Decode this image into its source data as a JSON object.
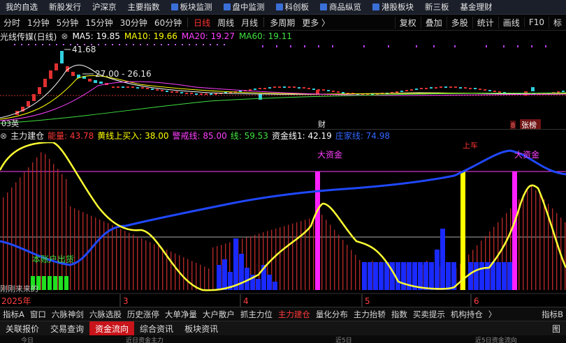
{
  "nav": {
    "items": [
      {
        "label": "我的自选",
        "icon": ""
      },
      {
        "label": "新股发行",
        "icon": ""
      },
      {
        "label": "沪深京",
        "icon": ""
      },
      {
        "label": "主要指数",
        "icon": ""
      },
      {
        "label": "板块监测",
        "icon": "board-icon"
      },
      {
        "label": "盘中监测",
        "icon": "monitor-icon"
      },
      {
        "label": "科创板",
        "icon": "star-icon"
      },
      {
        "label": "商品纵览",
        "icon": "commodity-icon"
      },
      {
        "label": "港股板块",
        "icon": "hk-icon"
      },
      {
        "label": "新三板",
        "icon": ""
      },
      {
        "label": "基金理财",
        "icon": ""
      }
    ]
  },
  "period": {
    "items": [
      "分时",
      "1分钟",
      "5分钟",
      "15分钟",
      "30分钟",
      "60分钟",
      "日线",
      "周线",
      "月线",
      "多周期",
      "更多 〉"
    ],
    "active": "日线",
    "right_items": [
      "复权",
      "叠加",
      "多股",
      "统计",
      "画线",
      "F10",
      "标"
    ]
  },
  "ma": {
    "title": "光线传媒(日线)",
    "ma5": "MA5: 19.85",
    "ma10": "MA10: 19.66",
    "ma20": "MA20: 19.27",
    "ma60": "MA60: 19.11",
    "colors": {
      "ma5": "#ffffff",
      "ma10": "#ffff00",
      "ma20": "#ff40ff",
      "ma60": "#40e040"
    }
  },
  "price_chart": {
    "high_label": "41.68",
    "range_label": "27.00 - 26.16",
    "low_label": "03英",
    "marker_cai": "财",
    "marker_eight": "8",
    "marker_zhangbang": "张榜"
  },
  "indicator": {
    "name": "主力建仓",
    "energy": "能量: 43.78",
    "yellow_buy": "黄线上买入: 38.00",
    "alert": "警戒线: 85.00",
    "line": "线: 59.53",
    "capital1": "资金线1: 42.19",
    "zhuang": "庄家线: 74.98",
    "colors": {
      "energy": "#ff3838",
      "yellow_buy": "#ffff00",
      "alert": "#ff40ff",
      "line": "#40e040",
      "capital1": "#ffffff",
      "zhuang": "#3366ff"
    }
  },
  "lower_chart": {
    "label_da_zijin": "大资金",
    "label_da_zijin_2": "大资金",
    "label_shang": "上车",
    "label_account": "本账户出货",
    "label_fresh": "刚刚来来的",
    "date_labels": [
      "2025年",
      "3",
      "4",
      "5",
      "6"
    ]
  },
  "tabs": {
    "items": [
      "指标A",
      "窗口",
      "六脉神剑",
      "六脉选股",
      "历史涨停",
      "大单净量",
      "大户散户",
      "抓主力位",
      "主力建仓",
      "量化分布",
      "主力抬轿",
      "指数",
      "买卖提示",
      "机构持仓",
      "〉"
    ],
    "active": "主力建仓",
    "right": "指标B"
  },
  "bottom": {
    "items": [
      "关联报价",
      "交易查询",
      "资金流向",
      "综合资讯",
      "板块资讯"
    ],
    "active": "资金流向",
    "right": "图"
  },
  "footer": {
    "items": [
      "今日",
      "近日资金主力",
      "近5日",
      "近5日资金流向"
    ]
  }
}
